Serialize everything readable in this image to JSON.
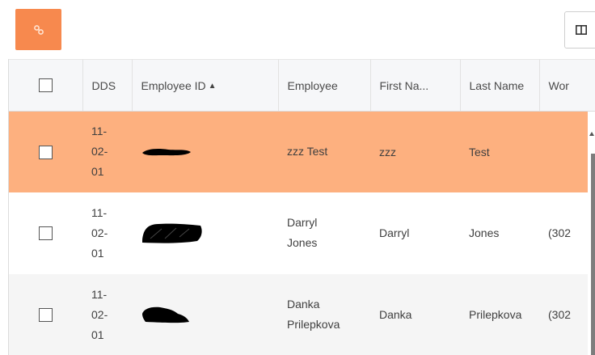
{
  "toolbar": {
    "link_button_icon": "link-icon",
    "link_button_color": "#f7894e",
    "column_chooser_icon": "columns-icon"
  },
  "grid": {
    "columns": {
      "dds": "DDS",
      "employee_id": "Employee ID",
      "employee": "Employee",
      "first_name": "First Na...",
      "last_name": "Last Name",
      "work": "Wor"
    },
    "sort": {
      "column": "Employee ID",
      "direction": "ascending"
    },
    "rows": [
      {
        "dds_line1": "11-",
        "dds_line2": "02-",
        "dds_line3": "01",
        "employee_line1": "zzz Test",
        "employee_line2": "",
        "first_name": "zzz",
        "last_name": "Test",
        "work": "",
        "highlight_color": "#fdb07f"
      },
      {
        "dds_line1": "11-",
        "dds_line2": "02-",
        "dds_line3": "01",
        "employee_line1": "Darryl",
        "employee_line2": "Jones",
        "first_name": "Darryl",
        "last_name": "Jones",
        "work": "(302"
      },
      {
        "dds_line1": "11-",
        "dds_line2": "02-",
        "dds_line3": "01",
        "employee_line1": "Danka",
        "employee_line2": "Prilepkova",
        "first_name": "Danka",
        "last_name": "Prilepkova",
        "work": "(302"
      }
    ]
  }
}
